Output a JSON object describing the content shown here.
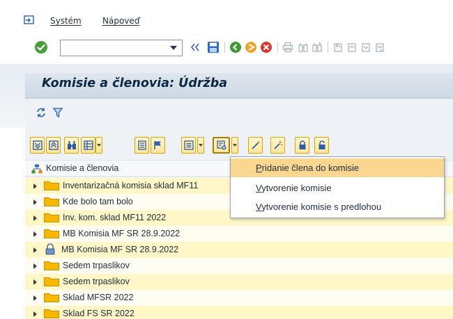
{
  "menubar": {
    "exit_icon": "exit-icon",
    "items": [
      {
        "label": "Systém"
      },
      {
        "label": "Nápoveď"
      }
    ]
  },
  "toolbar": {
    "command_value": "",
    "icons": [
      "ok-icon",
      "dropdown-icon",
      "back-double-arrow-icon",
      "save-icon",
      "back-icon",
      "exit-icon",
      "cancel-icon",
      "print-icon",
      "find-icon",
      "find-next-icon",
      "first-page-icon",
      "prev-page-icon",
      "next-page-icon",
      "last-page-icon"
    ]
  },
  "title": {
    "text": "Komisie a členovia: Údržba"
  },
  "app_toolbar": {
    "icons": [
      "refresh-icon",
      "filter-icon"
    ]
  },
  "tree_toolbar": {
    "icons": [
      "expand-all-icon",
      "collapse-all-icon",
      "find-icon",
      "layout-icon",
      "details-icon",
      "flag-icon",
      "list-menu-icon",
      "create-menu-icon",
      "wand-icon",
      "wand-sparkle-icon",
      "lock-icon",
      "unlock-icon"
    ]
  },
  "tree": {
    "header_label": "Komisie a členovia",
    "rows": [
      {
        "label": "Inventarizačná komisia sklad MF11",
        "icon": "folder-icon"
      },
      {
        "label": "Kde bolo tam bolo",
        "icon": "folder-icon"
      },
      {
        "label": "Inv. kom. sklad MF11 2022",
        "icon": "folder-icon"
      },
      {
        "label": "MB Komisia MF SR 28.9.2022",
        "icon": "folder-icon"
      },
      {
        "label": "MB Komisia MF SR 28.9.2022",
        "icon": "lock-icon"
      },
      {
        "label": "Sedem trpaslikov",
        "icon": "folder-icon"
      },
      {
        "label": "Sedem trpaslikov",
        "icon": "folder-icon"
      },
      {
        "label": "Sklad MFSR 2022",
        "icon": "folder-icon"
      },
      {
        "label": "Sklad FS SR 2022",
        "icon": "folder-icon"
      }
    ]
  },
  "context_menu": {
    "items": [
      {
        "label": "Pridanie člena do komisie"
      },
      {
        "label": "Vytvorenie komisie"
      },
      {
        "label": "Vytvorenie komisie s predlohou"
      }
    ]
  },
  "colors": {
    "selection_yellow": "#fff7c8",
    "menu_highlight": "#fad790",
    "folder": "#f6b800",
    "title_text": "#0b2844"
  }
}
